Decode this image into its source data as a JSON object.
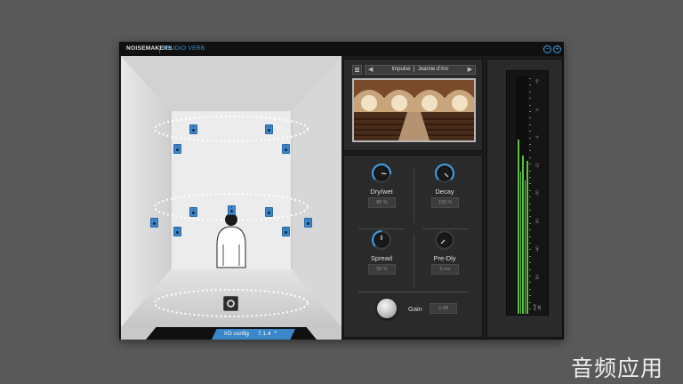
{
  "header": {
    "brand": "NOISEMAKERS",
    "product": "STUDIO VERB"
  },
  "window_buttons": {
    "minimize_icon": "minus-circle-icon",
    "add_icon": "plus-circle-icon"
  },
  "io_config": {
    "label": "I/O config",
    "value": "7.1.4"
  },
  "impulse": {
    "menu_icon": "hamburger-icon",
    "name": "Impulse",
    "separator": "|",
    "preset": "Jeanne d'Arc"
  },
  "knobs": [
    {
      "label": "Dry/wet",
      "value": "86 %",
      "level": 0.86
    },
    {
      "label": "Decay",
      "value": "100 %",
      "level": 1.0
    },
    {
      "label": "Spread",
      "value": "50 %",
      "level": 0.5
    },
    {
      "label": "Pre-Dly",
      "value": "0 ms",
      "level": 0.0
    }
  ],
  "gain": {
    "label": "Gain",
    "value": "0 dB"
  },
  "meter": {
    "scale": [
      "+6",
      "0",
      "-6",
      "-12",
      "-20",
      "-30",
      "-40",
      "-50",
      "-INF dB"
    ]
  },
  "watermark": "音频应用",
  "colors": {
    "accent": "#3a9de8",
    "speaker": "#3d86c9",
    "meter_green": "#5fbf3f"
  }
}
